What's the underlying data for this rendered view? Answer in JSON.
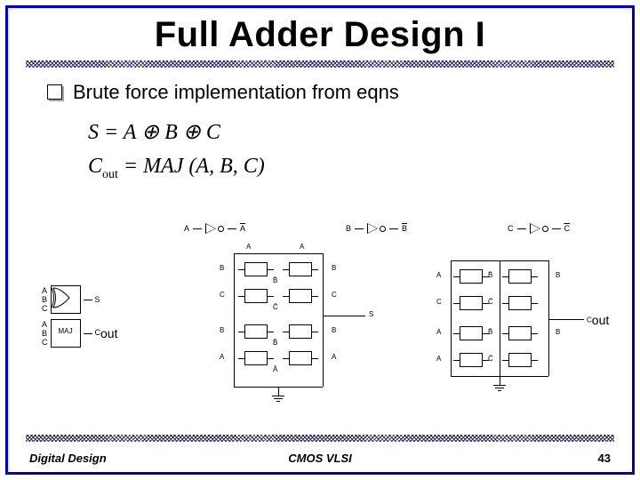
{
  "title": "Full Adder Design I",
  "bullet": "Brute force implementation from eqns",
  "eqn1_lhs": "S",
  "eqn1_rhs": "A ⊕ B ⊕ C",
  "eqn2_lhs_base": "C",
  "eqn2_lhs_sub": "out",
  "eqn2_rhs": "MAJ (A, B, C)",
  "inverters": [
    {
      "in": "A",
      "out": "A"
    },
    {
      "in": "B",
      "out": "B"
    },
    {
      "in": "C",
      "out": "C"
    }
  ],
  "logic": {
    "inputs_top": [
      "A",
      "B",
      "C"
    ],
    "out_top": "S",
    "maj_label": "MAJ",
    "inputs_bot": [
      "A",
      "B",
      "C"
    ],
    "out_bot_base": "C",
    "out_bot_sub": "out"
  },
  "schem_mid": {
    "top_labels": [
      "A",
      "A"
    ],
    "side_labels": [
      "B",
      "B̄",
      "B",
      "C",
      "C̄",
      "C",
      "B",
      "B̄",
      "B",
      "A",
      "Ā",
      "A"
    ],
    "out": "S"
  },
  "schem_right": {
    "side_labels": [
      "A",
      "B̄",
      "B",
      "C",
      "C̄",
      "A",
      "B̄",
      "B",
      "A",
      "C̄"
    ],
    "out_base": "C",
    "out_sub": "out"
  },
  "footer": {
    "left": "Digital Design",
    "center": "CMOS VLSI",
    "page": "43"
  }
}
